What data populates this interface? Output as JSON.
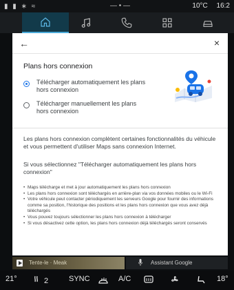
{
  "status": {
    "left_icons": "▮ ▮ ∗ ≈",
    "center": "— • —",
    "temperature": "10°C",
    "time": "16:2"
  },
  "nav": {
    "tabs": [
      {
        "icon": "home-icon",
        "active": true
      },
      {
        "icon": "music-icon",
        "active": false
      },
      {
        "icon": "phone-icon",
        "active": false
      },
      {
        "icon": "apps-grid-icon",
        "active": false
      },
      {
        "icon": "car-icon",
        "active": false
      }
    ]
  },
  "dialog": {
    "back_glyph": "←",
    "close_glyph": "×",
    "section_title": "Plans hors connexion",
    "options": [
      {
        "label": "Télécharger automatiquement les plans hors connexion",
        "selected": true
      },
      {
        "label": "Télécharger manuellement les plans hors connexion",
        "selected": false
      }
    ],
    "intro": "Les plans hors connexion complètent certaines fonctionnalités du véhicule et vous permettent d'utiliser Maps sans connexion Internet.",
    "subheading": "Si vous sélectionnez \"Télécharger automatiquement les plans hors connexion\"",
    "bullets": [
      "Maps télécharge et met à jour automatiquement les plans hors connexion",
      "Les plans hors connexion sont téléchargés en arrière-plan via vos données mobiles ou le Wi-Fi",
      "Votre véhicule peut contacter périodiquement les serveurs Google pour fournir des informations comme sa position, l'historique des positions et les plans hors connexion que vous avez déjà téléchargés",
      "Vous pouvez toujours sélectionner les plans hors connexion à télécharger",
      "Si vous désactivez cette option, les plans hors connexion déjà téléchargés seront conservés"
    ]
  },
  "media": {
    "text": "Tente-le · Meak"
  },
  "assistant": {
    "label": "Assistant Google"
  },
  "climate": {
    "left_temp": "21°",
    "seat": "2",
    "sync": "SYNC",
    "ac": "A/C",
    "right_temp": "18°"
  },
  "colors": {
    "accent": "#1a73e8",
    "nav_active": "#123a4a"
  }
}
